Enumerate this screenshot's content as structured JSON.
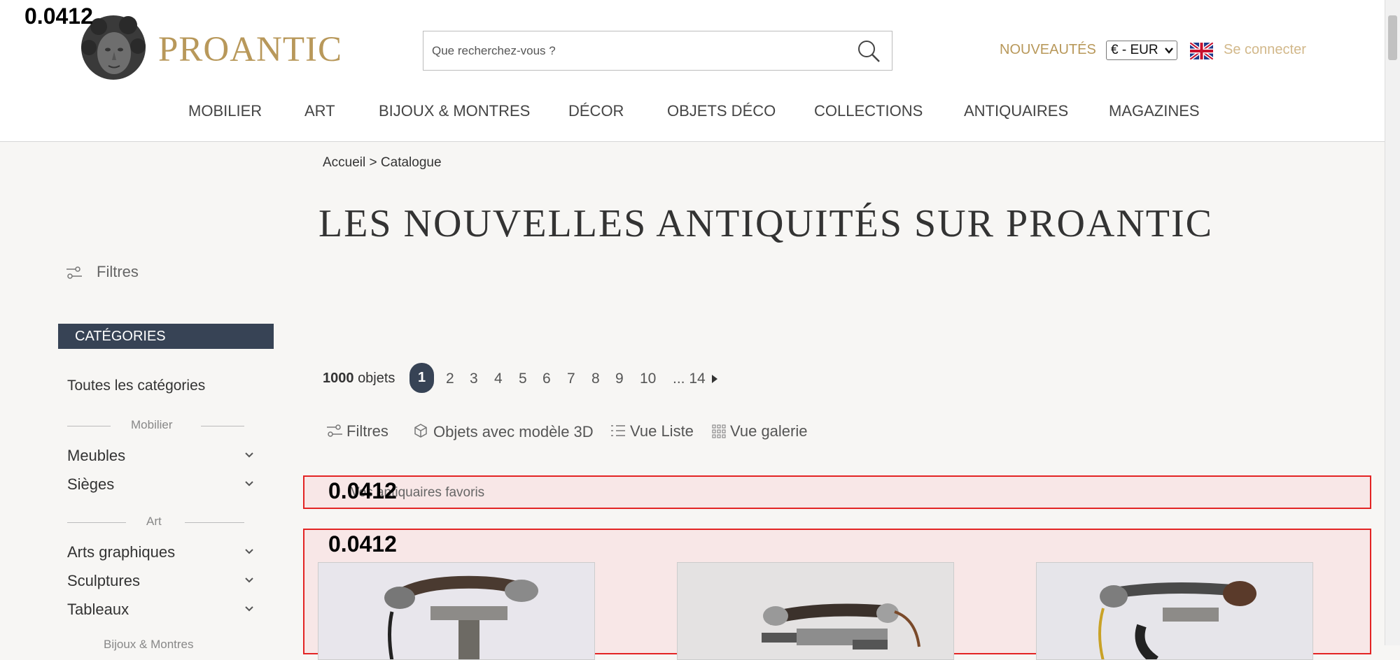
{
  "overlay_scores": {
    "top": "0.0412",
    "favorites": "0.0412",
    "grid": "0.0412"
  },
  "header": {
    "brand": "PROANTIC",
    "search_placeholder": "Que recherchez-vous ?",
    "nouveautes": "NOUVEAUTÉS",
    "currency": "€ - EUR",
    "login": "Se connecter"
  },
  "nav": [
    "MOBILIER",
    "ART",
    "BIJOUX & MONTRES",
    "DÉCOR",
    "OBJETS DÉCO",
    "COLLECTIONS",
    "ANTIQUAIRES",
    "MAGAZINES"
  ],
  "breadcrumb": "Accueil > Catalogue",
  "page_title": "LES NOUVELLES ANTIQUITÉS SUR PROANTIC",
  "sidebar": {
    "filters": "Filtres",
    "categories_header": "CATÉGORIES",
    "all_categories": "Toutes les catégories",
    "section_mobilier": "Mobilier",
    "meubles": "Meubles",
    "sieges": "Sièges",
    "section_art": "Art",
    "arts_graphiques": "Arts graphiques",
    "sculptures": "Sculptures",
    "tableaux": "Tableaux",
    "section_bijoux": "Bijoux & Montres"
  },
  "results": {
    "count": "1000",
    "count_label": "objets",
    "current_page": "1",
    "pages": [
      "2",
      "3",
      "4",
      "5",
      "6",
      "7",
      "8",
      "9",
      "10"
    ],
    "last_page": "... 14"
  },
  "toolbar": {
    "filters": "Filtres",
    "objects_3d": "Objets avec modèle 3D",
    "list_view": "Vue Liste",
    "gallery_view": "Vue galerie"
  },
  "favorites_text": "Vos antiquaires favoris",
  "colors": {
    "gold": "#b8985a",
    "navy": "#374355",
    "highlight_border": "#e32424"
  }
}
